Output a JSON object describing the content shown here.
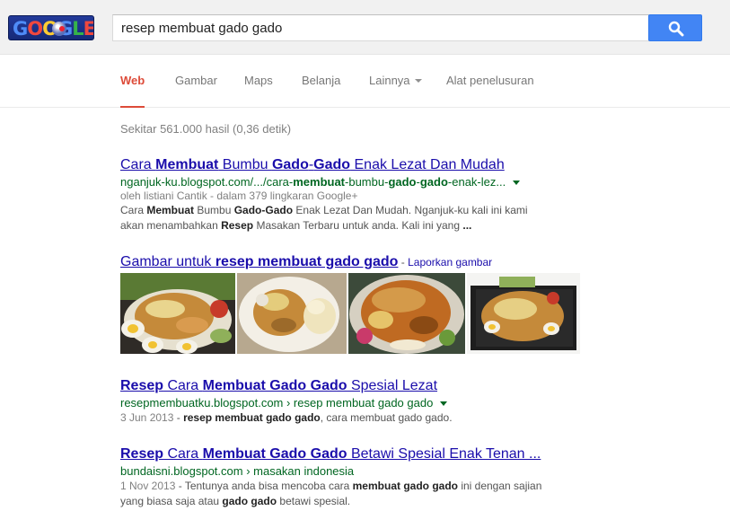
{
  "header": {
    "logo": {
      "letters": [
        "G",
        "O",
        "O",
        "G",
        "L",
        "E"
      ]
    },
    "search": {
      "value": "resep membuat gado gado",
      "button_icon": "search-icon"
    }
  },
  "nav": {
    "tabs": [
      {
        "label": "Web",
        "active": true
      },
      {
        "label": "Gambar"
      },
      {
        "label": "Maps"
      },
      {
        "label": "Belanja"
      },
      {
        "label": "Lainnya"
      },
      {
        "label": "Alat penelusuran"
      }
    ]
  },
  "stats": "Sekitar 561.000 hasil (0,36 detik)",
  "results": [
    {
      "title_parts": [
        "Cara ",
        "Membuat",
        " Bumbu ",
        "Gado",
        "-",
        "Gado",
        " Enak Lezat Dan Mudah"
      ],
      "url_parts": [
        "nganjuk-ku.blogspot.com/.../cara-",
        "membuat",
        "-bumbu-",
        "gado",
        "-",
        "gado",
        "-enak-lez..."
      ],
      "author": "oleh listiani Cantik - dalam 379 lingkaran Google+",
      "snippet_line1": [
        "Cara ",
        "Membuat",
        " Bumbu ",
        "Gado-Gado",
        " Enak Lezat Dan Mudah. Nganjuk-ku kali ini kami"
      ],
      "snippet_line2": [
        "akan menambahkan ",
        "Resep",
        " Masakan Terbaru untuk anda. Kali ini yang ",
        "..."
      ]
    },
    {
      "title_parts": [
        "Resep",
        " Cara ",
        "Membuat Gado Gado",
        " Spesial Lezat"
      ],
      "url": "resepmembuatku.blogspot.com › resep membuat gado gado",
      "date": "3 Jun 2013",
      "snippet": [
        "resep membuat gado gado",
        ", cara membuat gado gado."
      ]
    },
    {
      "title_parts": [
        "Resep",
        " Cara ",
        "Membuat Gado Gado",
        " Betawi Spesial Enak Tenan ..."
      ],
      "url": "bundaisni.blogspot.com › masakan indonesia",
      "date": "1 Nov 2013",
      "snippet_line1": [
        " - Tentunya anda bisa mencoba cara ",
        "membuat gado gado",
        " ini dengan sajian"
      ],
      "snippet_line2": [
        "yang biasa saja atau ",
        "gado gado",
        " betawi spesial."
      ]
    }
  ],
  "images": {
    "title_prefix": "Gambar untuk ",
    "title_query": "resep membuat gado gado",
    "separator": " - ",
    "report": "Laporkan gambar"
  }
}
